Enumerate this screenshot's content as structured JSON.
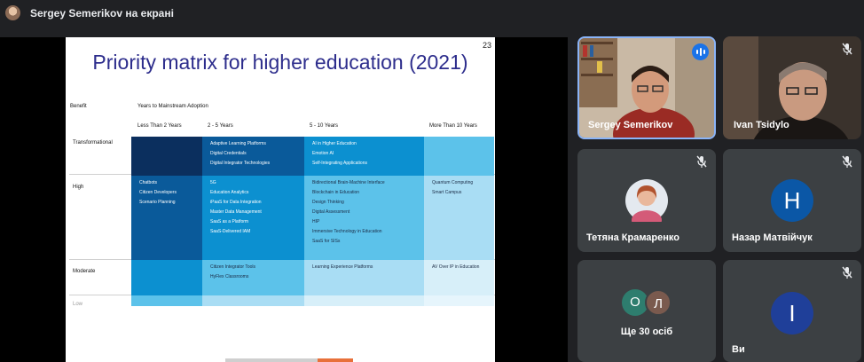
{
  "header": {
    "title": "Sergey Semerikov на екрані"
  },
  "slide": {
    "number": "23",
    "title": "Priority matrix for higher education (2021)",
    "benefit_label": "Benefit",
    "years_label": "Years to Mainstream Adoption",
    "columns": [
      "Less Than 2 Years",
      "2 - 5 Years",
      "5 - 10 Years",
      "More Than 10 Years"
    ],
    "rows": [
      "Transformational",
      "High",
      "Moderate",
      "Low"
    ],
    "cells": {
      "transformational_2_5": [
        "Adaptive Learning Platforms",
        "Digital Credentials",
        "Digital Integrator Technologies"
      ],
      "transformational_5_10": [
        "AI in Higher Education",
        "Emotion AI",
        "Self-Integrating Applications"
      ],
      "high_lt2": [
        "Chatbots",
        "Citizen Developers",
        "Scenario Planning"
      ],
      "high_2_5": [
        "5G",
        "Education Analytics",
        "iPaaS for Data Integration",
        "Master Data Management",
        "SaaS as a Platform",
        "SaaS-Delivered IAM"
      ],
      "high_5_10": [
        "Bidirectional Brain-Machine Interface",
        "Blockchain in Education",
        "Design Thinking",
        "Digital Assessment",
        "HIP",
        "Immersive Technology in Education",
        "SaaS for SISs"
      ],
      "high_gt10": [
        "Quantum Computing",
        "Smart Campus"
      ],
      "moderate_2_5": [
        "Citizen Integrator Tools",
        "HyFlex Classrooms"
      ],
      "moderate_5_10": [
        "Learning Experience Platforms"
      ],
      "moderate_gt10": [
        "AV Over IP in Education"
      ]
    },
    "colors": {
      "darkest": "#0b2f5e",
      "dark": "#0a5a9a",
      "mid": "#0c90d0",
      "light": "#5cc2ea",
      "lightest": "#a9ddf4"
    }
  },
  "participants": [
    {
      "name": "Sergey Semerikov",
      "status": "speaking"
    },
    {
      "name": "Ivan Tsidylo",
      "status": "muted"
    },
    {
      "name": "Тетяна Крамаренко",
      "status": "muted"
    },
    {
      "name": "Назар Матвійчук",
      "initial": "Н",
      "avatar_color": "#0b57a6",
      "status": "muted"
    },
    {
      "name": "Ще 30 осіб",
      "initials": [
        "О",
        "Л"
      ],
      "avatar_colors": [
        "#2e7d6e",
        "#7a5a4e"
      ]
    },
    {
      "name": "Ви",
      "initial": "І",
      "avatar_color": "#1f3f99",
      "status": "muted"
    }
  ]
}
